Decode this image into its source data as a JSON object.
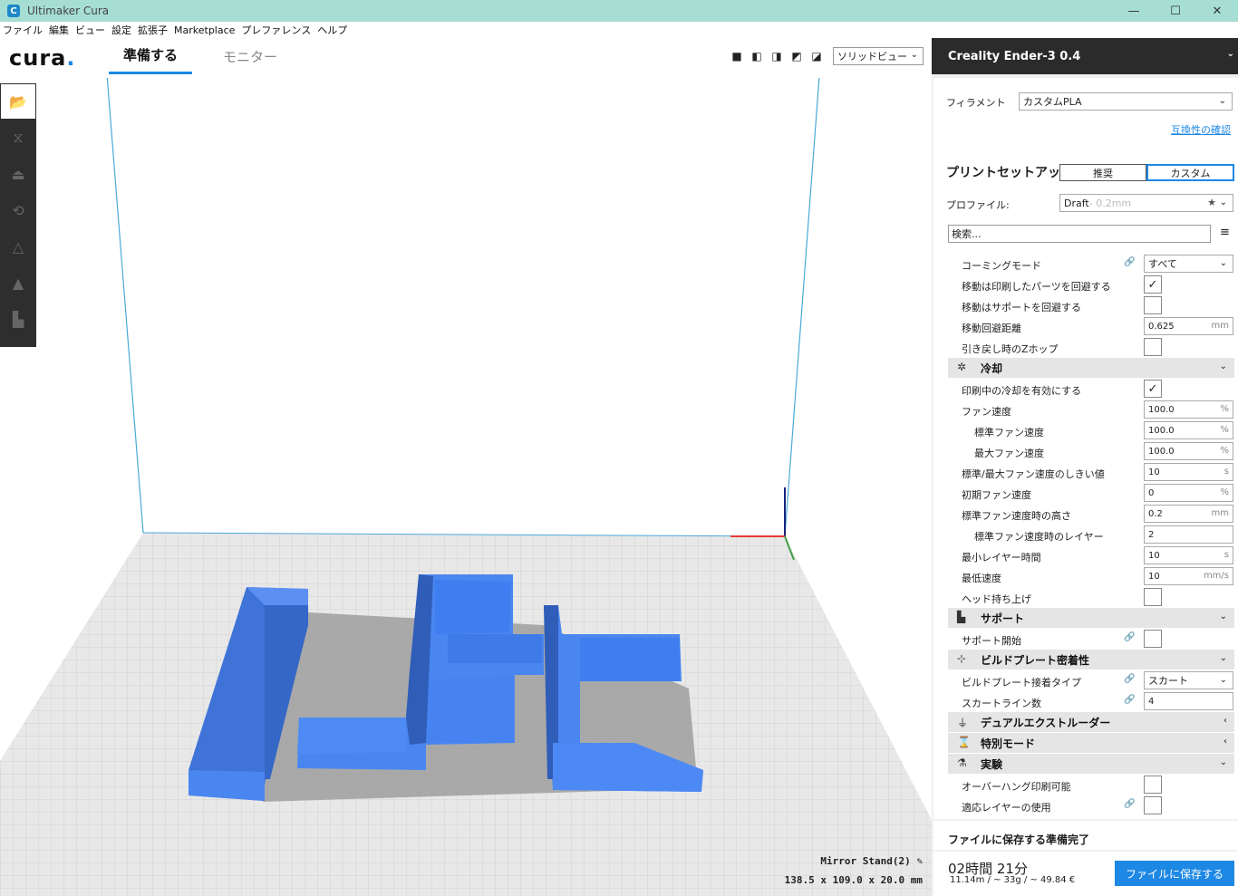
{
  "window": {
    "title": "Ultimaker Cura",
    "icon": "cura-app-icon",
    "controls": [
      "—",
      "☐",
      "✕"
    ]
  },
  "menu": [
    "ファイル",
    "編集",
    "ビュー",
    "設定",
    "拡張子",
    "Marketplace",
    "プレファレンス",
    "ヘルプ"
  ],
  "header": {
    "logo_text": "cura",
    "logo_dot": ".",
    "tabs": [
      {
        "label": "準備する",
        "active": true
      },
      {
        "label": "モニター",
        "active": false
      }
    ],
    "view_mode": "ソリッドビュー"
  },
  "toolbar": {
    "tools": [
      "open-folder-icon",
      "move-icon",
      "scale-icon",
      "rotate-icon",
      "mirror-icon",
      "per-model-settings-icon",
      "support-blocker-icon"
    ]
  },
  "object": {
    "name": "Mirror Stand(2)",
    "dimensions": "138.5 x 109.0 x 20.0 mm"
  },
  "panel": {
    "printer": "Creality Ender-3 0.4",
    "filament_label": "フィラメント",
    "filament_value": "カスタムPLA",
    "compat_link": "互換性の確認",
    "setup_title": "プリントセットアップ",
    "mode_recommended": "推奨",
    "mode_custom": "カスタム",
    "profile_label": "プロファイル:",
    "profile_value": "Draft",
    "profile_layer": " - 0.2mm",
    "search_placeholder": "検索...",
    "settings": [
      {
        "type": "select",
        "label": "コーミングモード",
        "value": "すべて",
        "link": true
      },
      {
        "type": "check",
        "label": "移動は印刷したパーツを回避する",
        "checked": true
      },
      {
        "type": "check",
        "label": "移動はサポートを回避する",
        "checked": false
      },
      {
        "type": "input",
        "label": "移動回避距離",
        "value": "0.625",
        "unit": "mm"
      },
      {
        "type": "check",
        "label": "引き戻し時のZホップ",
        "checked": false
      },
      {
        "type": "category",
        "label": "冷却",
        "icon": "fan-icon",
        "open": true
      },
      {
        "type": "check",
        "label": "印刷中の冷却を有効にする",
        "checked": true
      },
      {
        "type": "input",
        "label": "ファン速度",
        "value": "100.0",
        "unit": "%"
      },
      {
        "type": "input",
        "label": "標準ファン速度",
        "value": "100.0",
        "unit": "%",
        "indent": true
      },
      {
        "type": "input",
        "label": "最大ファン速度",
        "value": "100.0",
        "unit": "%",
        "indent": true
      },
      {
        "type": "input",
        "label": "標準/最大ファン速度のしきい値",
        "value": "10",
        "unit": "s"
      },
      {
        "type": "input",
        "label": "初期ファン速度",
        "value": "0",
        "unit": "%"
      },
      {
        "type": "input",
        "label": "標準ファン速度時の高さ",
        "value": "0.2",
        "unit": "mm"
      },
      {
        "type": "input",
        "label": "標準ファン速度時のレイヤー",
        "value": "2",
        "unit": "",
        "indent": true
      },
      {
        "type": "input",
        "label": "最小レイヤー時間",
        "value": "10",
        "unit": "s"
      },
      {
        "type": "input",
        "label": "最低速度",
        "value": "10",
        "unit": "mm/s"
      },
      {
        "type": "check",
        "label": "ヘッド持ち上げ",
        "checked": false
      },
      {
        "type": "category",
        "label": "サポート",
        "icon": "support-icon",
        "open": true
      },
      {
        "type": "check",
        "label": "サポート開始",
        "checked": false,
        "link": true
      },
      {
        "type": "category",
        "label": "ビルドプレート密着性",
        "icon": "adhesion-icon",
        "open": true
      },
      {
        "type": "select",
        "label": "ビルドプレート接着タイプ",
        "value": "スカート",
        "link": true
      },
      {
        "type": "input",
        "label": "スカートライン数",
        "value": "4",
        "unit": "",
        "link": true
      },
      {
        "type": "category",
        "label": "デュアルエクストルーダー",
        "icon": "dual-extruder-icon",
        "open": false
      },
      {
        "type": "category",
        "label": "特別モード",
        "icon": "special-mode-icon",
        "open": false
      },
      {
        "type": "category",
        "label": "実験",
        "icon": "experimental-icon",
        "open": true
      },
      {
        "type": "check",
        "label": "オーバーハング印刷可能",
        "checked": false
      },
      {
        "type": "check",
        "label": "適応レイヤーの使用",
        "checked": false,
        "link": true
      }
    ],
    "status": "ファイルに保存する準備完了",
    "time": "02時間 21分",
    "stats": "11.14m / ~ 33g / ~ 49.84 €",
    "save_button": "ファイルに保存する"
  },
  "colors": {
    "accent": "#1e88e5",
    "model": "#4a86f0",
    "plate": "#e6e6e6",
    "dark": "#2b2b2b"
  }
}
